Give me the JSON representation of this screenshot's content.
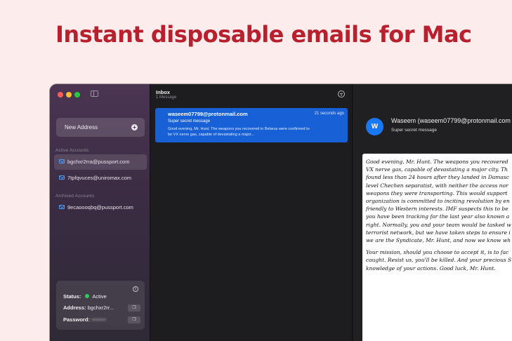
{
  "headline": "Instant disposable emails for Mac",
  "sidebar": {
    "new_address_label": "New Address",
    "active_label": "Active Accounts",
    "active": [
      "bgchxr2rra@pussport.com",
      "7tpfqvuces@uniromax.com"
    ],
    "archived_label": "Archived Accounts",
    "archived": [
      "9ecaoooqbq@pussport.com"
    ],
    "status": {
      "status_key": "Status:",
      "status_value": "Active",
      "address_key": "Address:",
      "address_value": "bgchxr2rr...",
      "password_key": "Password:",
      "password_value": "••••••••"
    }
  },
  "inbox": {
    "title": "Inbox",
    "count": "1 Message",
    "message": {
      "from": "waseem07799@protonmail.com",
      "time": "21 seconds ago",
      "subject": "Super secret message",
      "preview_line1": "Good evening, Mr. Hunt. The weapons you recovered in Belarus were confirmed to",
      "preview_line2": "be VX nerve gas, capable of devastating a major..."
    }
  },
  "detail": {
    "avatar_letter": "W",
    "sender": "Waseem (waseem07799@protonmail.com",
    "subject": "Super secret message",
    "para1": [
      "Good evening, Mr. Hunt. The weapons you recovered",
      "VX nerve gas, capable of devastating a major city. Th",
      "found less than 24 hours after they landed in Damasc",
      "level Chechen separatist, with neither the access nor",
      "weapons they were transporting. This would support",
      "organization is committed to inciting revolution by en",
      "friendly to Western interests. IMF suspects this to be",
      "you have been tracking for the last year also known a",
      "right. Normally, you and your team would be tasked w",
      "terrorist network, but we have taken steps to ensure i",
      "we are the Syndicate, Mr. Hunt, and now we know wh"
    ],
    "para2": [
      "Your mission, should you choose to accept it, is to fac",
      "caught. Resist us, you'll be killed. And your precious S",
      "knowledge of your actions. Good luck, Mr. Hunt."
    ]
  },
  "colors": {
    "headline": "#b8202e",
    "accent": "#1860d6",
    "active_dot": "#2ecc55"
  }
}
